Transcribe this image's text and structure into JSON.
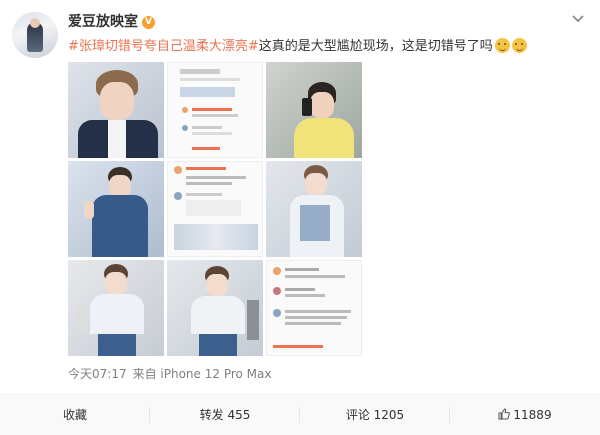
{
  "author": {
    "name": "爱豆放映室",
    "verified_icon": "v-badge-icon",
    "badge_color": "#f3a22e"
  },
  "post": {
    "hashtag": "#张璋切错号夸自己温柔大漂亮#",
    "text": "这真的是大型尴尬现场，这是切错号了吗",
    "emojis": [
      "smile-emoji-icon",
      "smile-emoji-icon"
    ],
    "tag_color": "#eb7350"
  },
  "images": [
    {
      "name": "photo-1",
      "desc_icon": "portrait-photo"
    },
    {
      "name": "photo-2",
      "desc_icon": "comment-screenshot"
    },
    {
      "name": "photo-3",
      "desc_icon": "selfie-photo"
    },
    {
      "name": "photo-4",
      "desc_icon": "airport-photo"
    },
    {
      "name": "photo-5",
      "desc_icon": "comment-screenshot"
    },
    {
      "name": "photo-6",
      "desc_icon": "airport-photo"
    },
    {
      "name": "photo-7",
      "desc_icon": "airport-photo"
    },
    {
      "name": "photo-8",
      "desc_icon": "airport-photo"
    },
    {
      "name": "photo-9",
      "desc_icon": "comment-screenshot"
    }
  ],
  "meta": {
    "time": "今天07:17",
    "source": "来自 iPhone 12 Pro Max"
  },
  "actions": {
    "favorite": "收藏",
    "repost": "转发 455",
    "comment": "评论 1205",
    "like": "11889"
  }
}
